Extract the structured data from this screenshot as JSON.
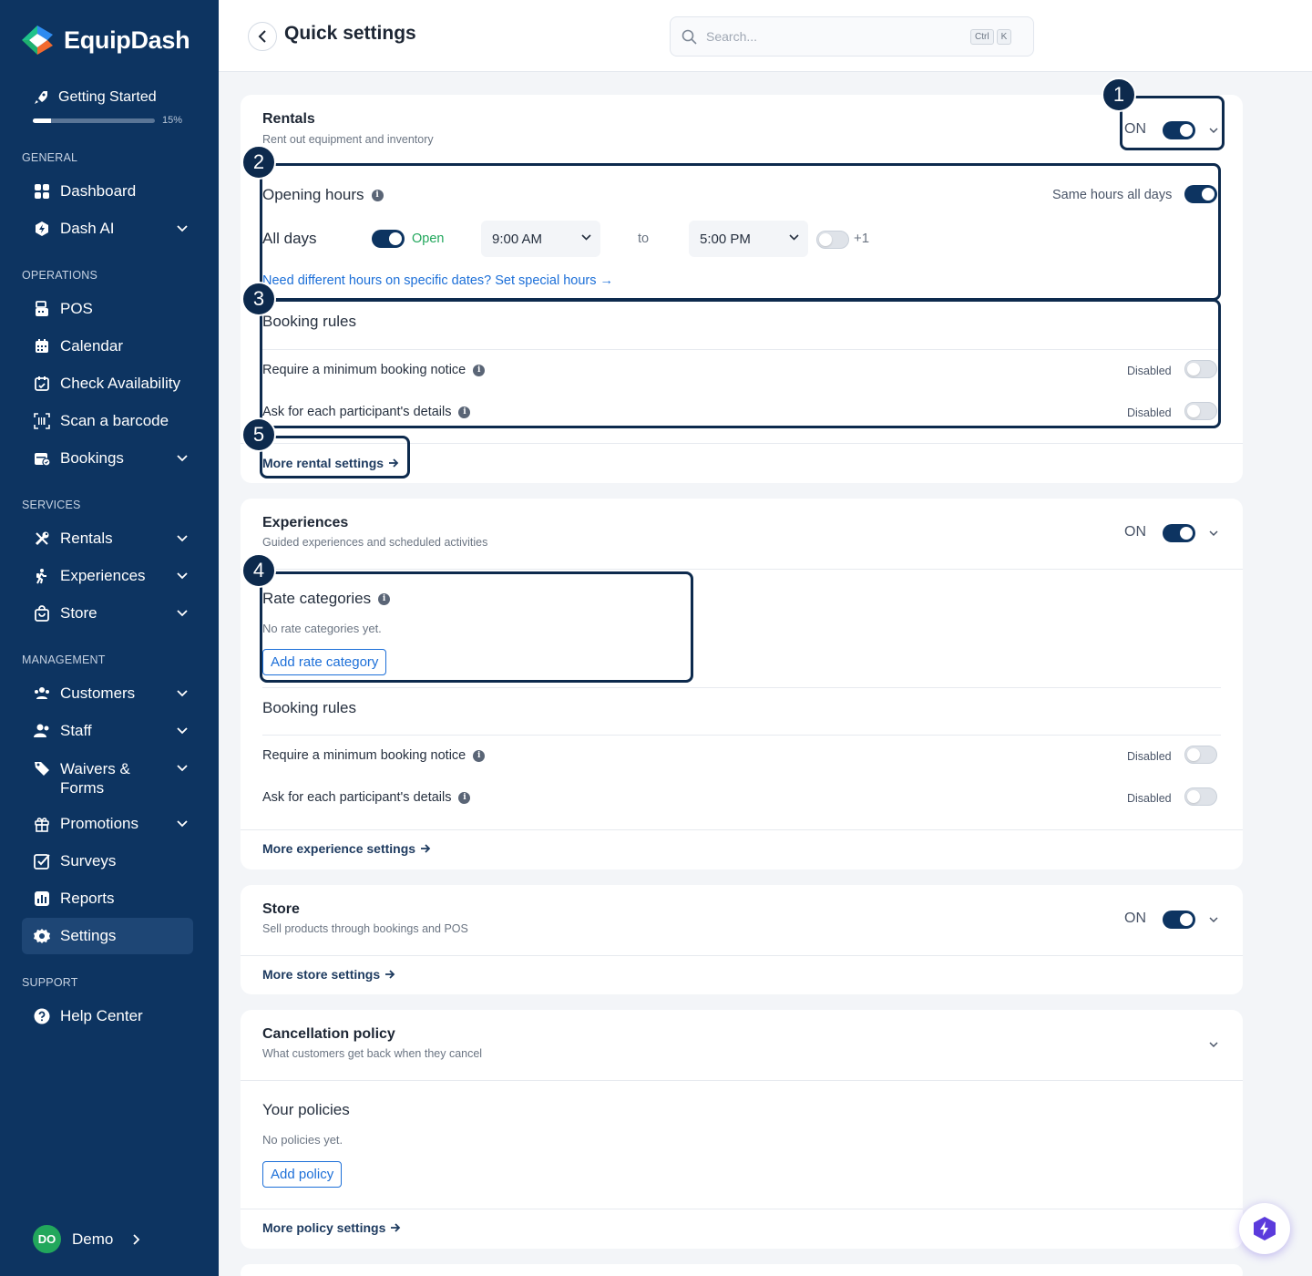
{
  "app": {
    "name": "EquipDash"
  },
  "getting_started": {
    "label": "Getting Started",
    "percent_label": "15%",
    "progress": 0.15
  },
  "sidebar": {
    "sections": {
      "general": "GENERAL",
      "operations": "OPERATIONS",
      "services": "SERVICES",
      "management": "MANAGEMENT",
      "support": "SUPPORT"
    },
    "items": {
      "dashboard": "Dashboard",
      "dash_ai": "Dash AI",
      "pos": "POS",
      "calendar": "Calendar",
      "check_availability": "Check Availability",
      "scan_barcode": "Scan a barcode",
      "bookings": "Bookings",
      "rentals": "Rentals",
      "experiences": "Experiences",
      "store": "Store",
      "customers": "Customers",
      "staff": "Staff",
      "waivers_line1": "Waivers &",
      "waivers_line2": "Forms",
      "promotions": "Promotions",
      "surveys": "Surveys",
      "reports": "Reports",
      "settings": "Settings",
      "help_center": "Help Center"
    },
    "active_item": "settings"
  },
  "user": {
    "initials": "DO",
    "name": "Demo"
  },
  "header": {
    "title": "Quick settings",
    "search_placeholder": "Search...",
    "kbd_ctrl": "Ctrl",
    "kbd_k": "K"
  },
  "rentals": {
    "title": "Rentals",
    "subtitle": "Rent out equipment and inventory",
    "state": "ON",
    "opening_hours": "Opening hours",
    "same_hours": "Same hours all days",
    "all_days": "All days",
    "open": "Open",
    "from": "9:00 AM",
    "to_word": "to",
    "to": "5:00 PM",
    "plus_one": "+1",
    "special_hours_link": "Need different hours on specific dates? Set special hours →",
    "booking_rules": "Booking rules",
    "rule1": "Require a minimum booking notice",
    "rule1_state": "Disabled",
    "rule2": "Ask for each participant's details",
    "rule2_state": "Disabled",
    "more": "More rental settings"
  },
  "experiences": {
    "title": "Experiences",
    "subtitle": "Guided experiences and scheduled activities",
    "state": "ON",
    "rate_categories": "Rate categories",
    "no_rates": "No rate categories yet.",
    "add_rate": "Add rate category",
    "booking_rules": "Booking rules",
    "rule1": "Require a minimum booking notice",
    "rule1_state": "Disabled",
    "rule2": "Ask for each participant's details",
    "rule2_state": "Disabled",
    "more": "More experience settings"
  },
  "store": {
    "title": "Store",
    "subtitle": "Sell products through bookings and POS",
    "state": "ON",
    "more": "More store settings"
  },
  "cancellation": {
    "title": "Cancellation policy",
    "subtitle": "What customers get back when they cancel",
    "your_policies": "Your policies",
    "no_policies": "No policies yet.",
    "add_policy": "Add policy",
    "more": "More policy settings"
  },
  "annotations": [
    "1",
    "2",
    "3",
    "4",
    "5"
  ],
  "colors": {
    "sidebar": "#0d3461",
    "accent": "#1c6fd8",
    "open_green": "#22a75c",
    "annotation": "#0d2a4d"
  }
}
